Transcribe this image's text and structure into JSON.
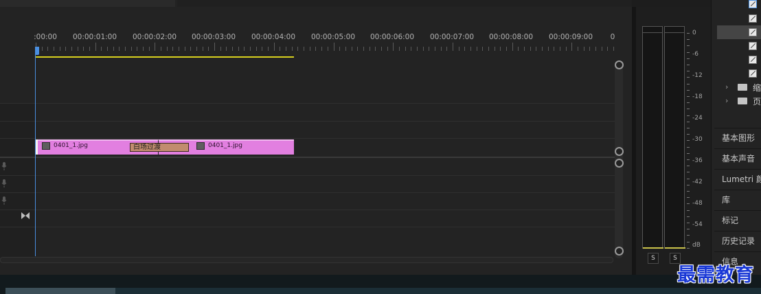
{
  "timeline": {
    "ruler_labels": [
      ":00:00",
      "00:00:01:00",
      "00:00:02:00",
      "00:00:03:00",
      "00:00:04:00",
      "00:00:05:00",
      "00:00:06:00",
      "00:00:07:00",
      "00:00:08:00",
      "00:00:09:00",
      "0"
    ],
    "clips": [
      {
        "name": "0401_1.jpg"
      },
      {
        "name": "0401_1.jpg"
      }
    ],
    "transition_label": "白场过渡",
    "colors": {
      "clip": "#e27fe0",
      "transition": "#c18c6e",
      "playhead": "#4a8fe0",
      "work_area": "#d8d01e"
    }
  },
  "audio_meter": {
    "db_labels": [
      "0",
      "-6",
      "-12",
      "-18",
      "-24",
      "-30",
      "-36",
      "-42",
      "-48",
      "-54",
      "dB"
    ],
    "solo_buttons": [
      "S",
      "S"
    ]
  },
  "right_panel": {
    "folders": [
      {
        "name": "缩"
      },
      {
        "name": "页"
      }
    ],
    "tabs": [
      "基本图形",
      "基本声音",
      "Lumetri 颜",
      "库",
      "标记",
      "历史记录",
      "信息"
    ]
  },
  "watermark": "最需教育"
}
